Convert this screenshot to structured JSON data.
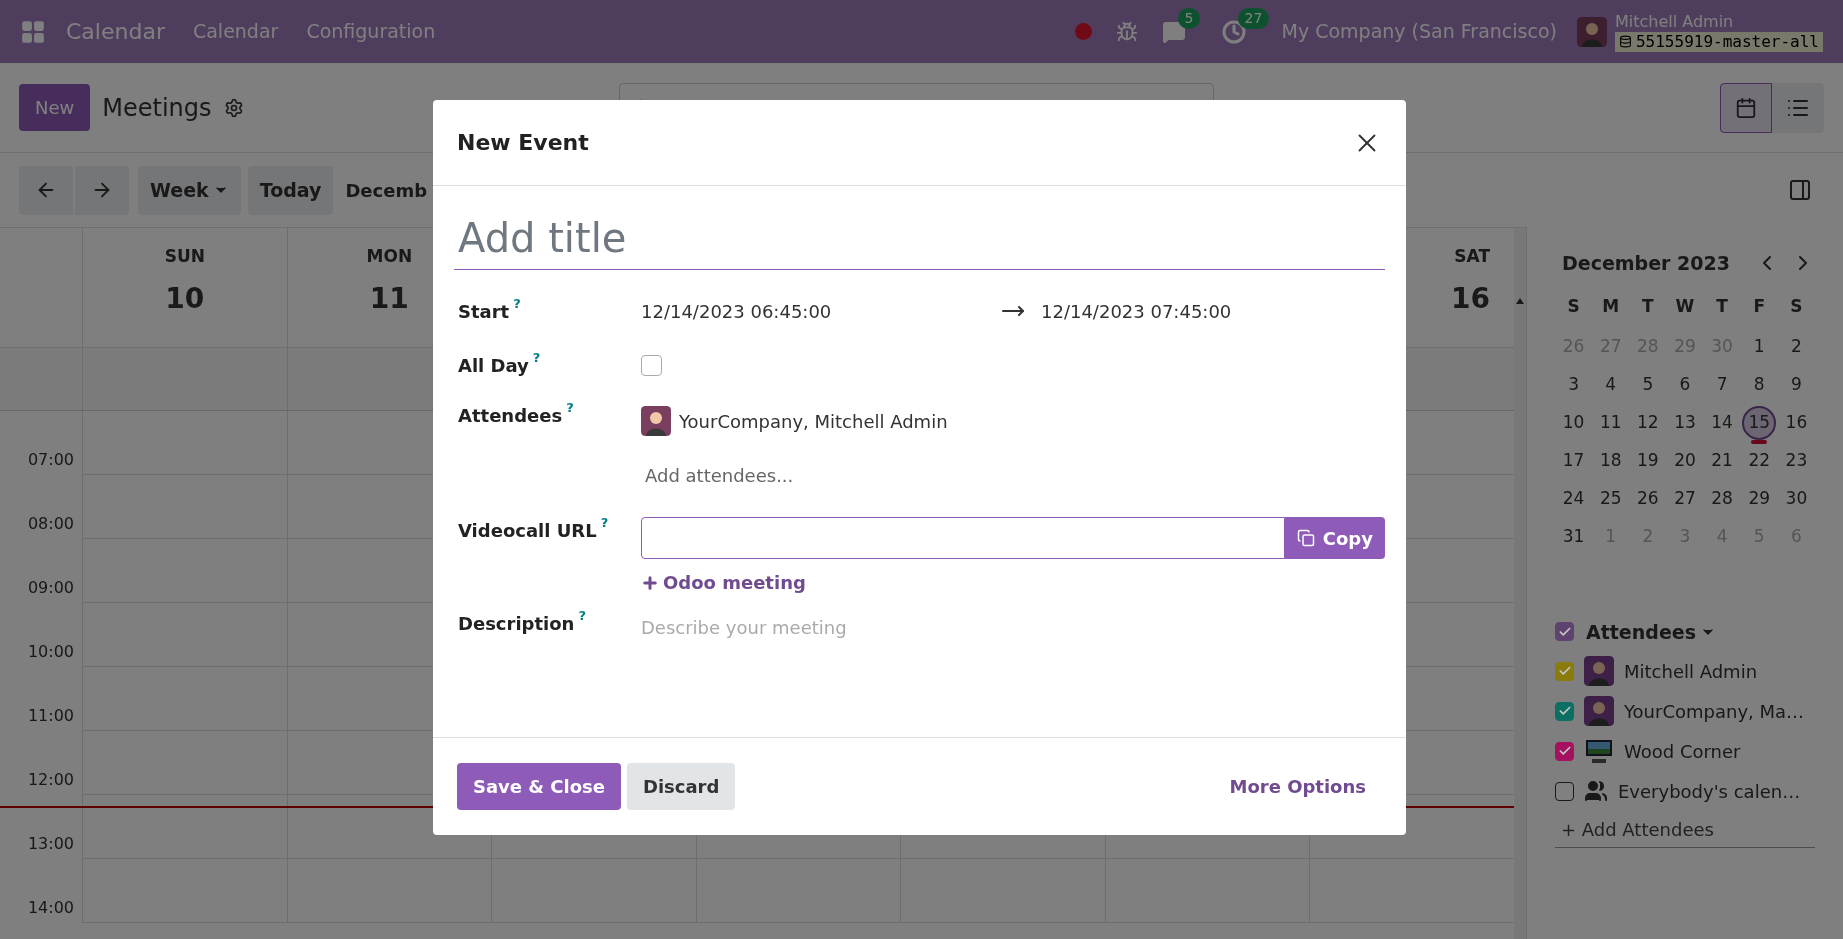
{
  "topbar": {
    "app_name": "Calendar",
    "menu": [
      "Calendar",
      "Configuration"
    ],
    "chat_count": "5",
    "activity_count": "27",
    "company": "My Company (San Francisco)",
    "user": "Mitchell Admin",
    "database": "55155919-master-all"
  },
  "control_panel": {
    "new_button": "New",
    "title": "Meetings"
  },
  "nav": {
    "scale": "Week",
    "today": "Today",
    "period": "Decemb"
  },
  "calendar": {
    "days": [
      {
        "name": "SUN",
        "date": "10"
      },
      {
        "name": "MON",
        "date": "11"
      },
      {
        "name": "SAT",
        "date": "16"
      }
    ],
    "hours": [
      "07:00",
      "08:00",
      "09:00",
      "10:00",
      "11:00",
      "12:00",
      "13:00",
      "14:00"
    ]
  },
  "mini_calendar": {
    "month": "December 2023",
    "weekdays": [
      "S",
      "M",
      "T",
      "W",
      "T",
      "F",
      "S"
    ],
    "weeks": [
      [
        {
          "d": "26",
          "other": true,
          "selected": false
        },
        {
          "d": "27",
          "other": true,
          "selected": false
        },
        {
          "d": "28",
          "other": true,
          "selected": false
        },
        {
          "d": "29",
          "other": true,
          "selected": false
        },
        {
          "d": "30",
          "other": true,
          "selected": false
        },
        {
          "d": "1",
          "other": false,
          "selected": false
        },
        {
          "d": "2",
          "other": false,
          "selected": false
        }
      ],
      [
        {
          "d": "3",
          "other": false,
          "selected": false
        },
        {
          "d": "4",
          "other": false,
          "selected": false
        },
        {
          "d": "5",
          "other": false,
          "selected": false
        },
        {
          "d": "6",
          "other": false,
          "selected": false
        },
        {
          "d": "7",
          "other": false,
          "selected": false
        },
        {
          "d": "8",
          "other": false,
          "selected": false
        },
        {
          "d": "9",
          "other": false,
          "selected": false
        }
      ],
      [
        {
          "d": "10",
          "other": false,
          "selected": false
        },
        {
          "d": "11",
          "other": false,
          "selected": false
        },
        {
          "d": "12",
          "other": false,
          "selected": false
        },
        {
          "d": "13",
          "other": false,
          "selected": false
        },
        {
          "d": "14",
          "other": false,
          "selected": false
        },
        {
          "d": "15",
          "other": false,
          "selected": true
        },
        {
          "d": "16",
          "other": false,
          "selected": false
        }
      ],
      [
        {
          "d": "17",
          "other": false,
          "selected": false
        },
        {
          "d": "18",
          "other": false,
          "selected": false
        },
        {
          "d": "19",
          "other": false,
          "selected": false
        },
        {
          "d": "20",
          "other": false,
          "selected": false
        },
        {
          "d": "21",
          "other": false,
          "selected": false
        },
        {
          "d": "22",
          "other": false,
          "selected": false
        },
        {
          "d": "23",
          "other": false,
          "selected": false
        }
      ],
      [
        {
          "d": "24",
          "other": false,
          "selected": false
        },
        {
          "d": "25",
          "other": false,
          "selected": false
        },
        {
          "d": "26",
          "other": false,
          "selected": false
        },
        {
          "d": "27",
          "other": false,
          "selected": false
        },
        {
          "d": "28",
          "other": false,
          "selected": false
        },
        {
          "d": "29",
          "other": false,
          "selected": false
        },
        {
          "d": "30",
          "other": false,
          "selected": false
        }
      ],
      [
        {
          "d": "31",
          "other": false,
          "selected": false
        },
        {
          "d": "1",
          "other": true,
          "selected": false
        },
        {
          "d": "2",
          "other": true,
          "selected": false
        },
        {
          "d": "3",
          "other": true,
          "selected": false
        },
        {
          "d": "4",
          "other": true,
          "selected": false
        },
        {
          "d": "5",
          "other": true,
          "selected": false
        },
        {
          "d": "6",
          "other": true,
          "selected": false
        }
      ]
    ]
  },
  "attendees_filter": {
    "label": "Attendees",
    "checked": true,
    "color": "#5e4270",
    "items": [
      {
        "name": "Mitchell Admin",
        "checked": true,
        "color": "#8b7a0c",
        "kind": "avatar"
      },
      {
        "name": "YourCompany, Ma…",
        "checked": true,
        "color": "#0d6e64",
        "kind": "avatar"
      },
      {
        "name": "Wood Corner",
        "checked": true,
        "color": "#a3115f",
        "kind": "logo"
      },
      {
        "name": "Everybody's calen…",
        "checked": false,
        "kind": "group"
      }
    ],
    "add_link": "+ Add Attendees"
  },
  "dialog": {
    "title": "New Event",
    "title_placeholder": "Add title",
    "start": {
      "label": "Start",
      "help": "?",
      "from": "12/14/2023 06:45:00",
      "to": "12/14/2023 07:45:00"
    },
    "all_day": {
      "label": "All Day",
      "help": "?",
      "checked": false
    },
    "attendees": {
      "label": "Attendees",
      "help": "?",
      "tags": [
        "YourCompany, Mitchell Admin"
      ],
      "placeholder": "Add attendees..."
    },
    "videocall": {
      "label": "Videocall URL",
      "help": "?",
      "copy": "Copy",
      "link": "Odoo meeting"
    },
    "description": {
      "label": "Description",
      "help": "?",
      "placeholder": "Describe your meeting"
    },
    "buttons": {
      "save": "Save & Close",
      "discard": "Discard",
      "more": "More Options"
    }
  }
}
